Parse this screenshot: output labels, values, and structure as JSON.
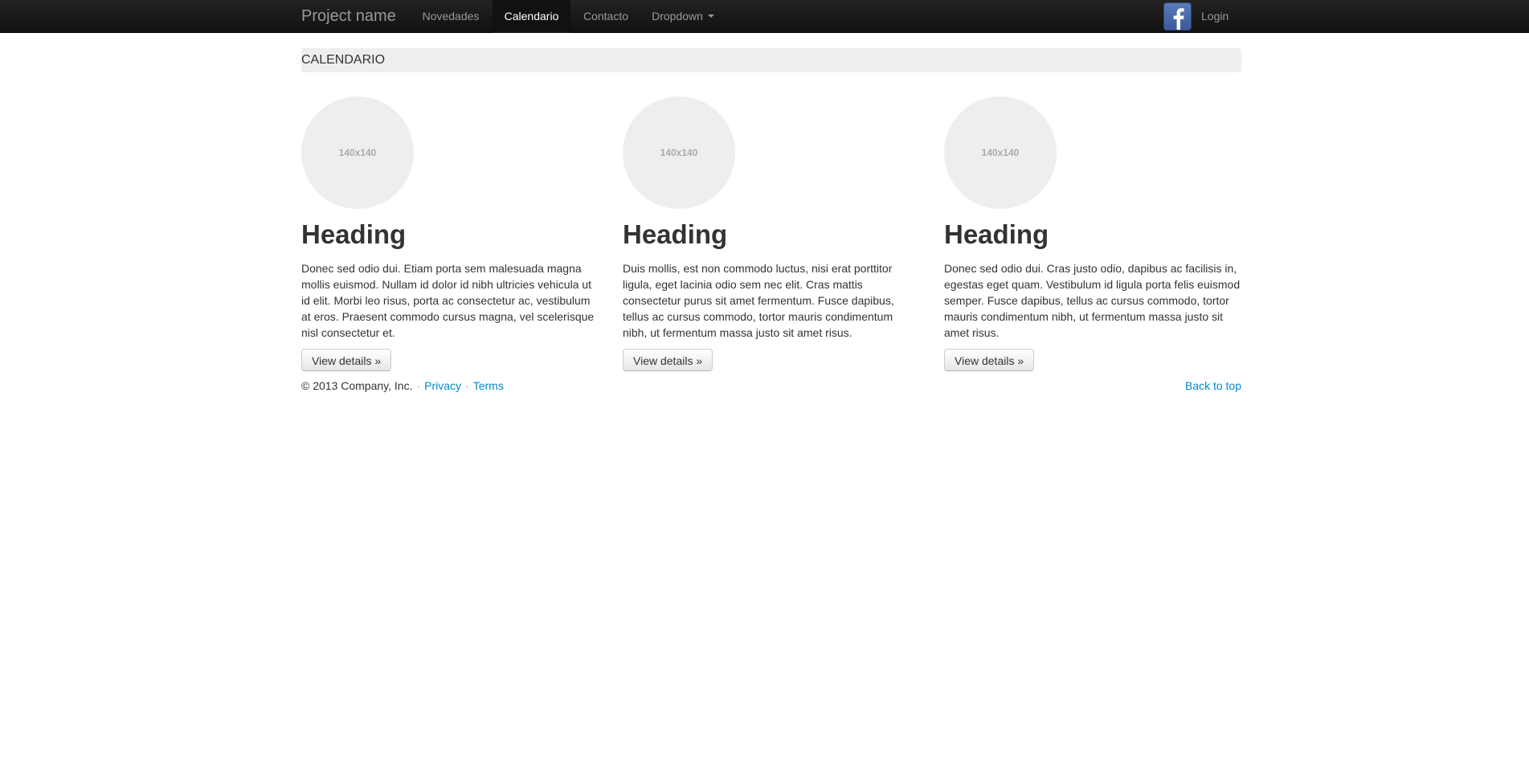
{
  "navbar": {
    "brand": "Project name",
    "items": [
      {
        "label": "Novedades"
      },
      {
        "label": "Calendario"
      },
      {
        "label": "Contacto"
      },
      {
        "label": "Dropdown"
      }
    ],
    "login": "Login",
    "active_item": "Calendario"
  },
  "page": {
    "title": "CALENDARIO"
  },
  "columns": [
    {
      "placeholder": "140x140",
      "heading": "Heading",
      "text": "Donec sed odio dui. Etiam porta sem malesuada magna mollis euismod. Nullam id dolor id nibh ultricies vehicula ut id elit. Morbi leo risus, porta ac consectetur ac, vestibulum at eros. Praesent commodo cursus magna, vel scelerisque nisl consectetur et.",
      "button": "View details »"
    },
    {
      "placeholder": "140x140",
      "heading": "Heading",
      "text": "Duis mollis, est non commodo luctus, nisi erat porttitor ligula, eget lacinia odio sem nec elit. Cras mattis consectetur purus sit amet fermentum. Fusce dapibus, tellus ac cursus commodo, tortor mauris condimentum nibh, ut fermentum massa justo sit amet risus.",
      "button": "View details »"
    },
    {
      "placeholder": "140x140",
      "heading": "Heading",
      "text": "Donec sed odio dui. Cras justo odio, dapibus ac facilisis in, egestas eget quam. Vestibulum id ligula porta felis euismod semper. Fusce dapibus, tellus ac cursus commodo, tortor mauris condimentum nibh, ut fermentum massa justo sit amet risus.",
      "button": "View details »"
    }
  ],
  "footer": {
    "copyright": "© 2013 Company, Inc.",
    "separator": "·",
    "privacy": "Privacy",
    "terms": "Terms",
    "back_to_top": "Back to top"
  },
  "icons": {
    "facebook": "facebook-icon",
    "dropdown_caret": "caret-down-icon"
  },
  "colors": {
    "navbar_bg": "#1b1b1b",
    "link": "#0088cc",
    "placeholder_bg": "#eeeeee"
  }
}
